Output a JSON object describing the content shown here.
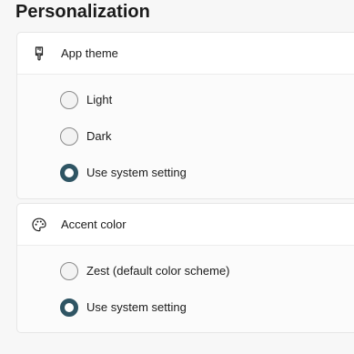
{
  "page": {
    "title": "Personalization"
  },
  "app_theme": {
    "label": "App theme",
    "icon": "paintbrush-icon",
    "options": [
      {
        "label": "Light",
        "selected": false
      },
      {
        "label": "Dark",
        "selected": false
      },
      {
        "label": "Use system setting",
        "selected": true
      }
    ]
  },
  "accent_color": {
    "label": "Accent color",
    "icon": "palette-icon",
    "options": [
      {
        "label": "Zest (default color scheme)",
        "selected": false
      },
      {
        "label": "Use system setting",
        "selected": true
      }
    ]
  },
  "colors": {
    "radio_selected": "#2f5564",
    "radio_unselected_border": "#8a8a8a"
  }
}
